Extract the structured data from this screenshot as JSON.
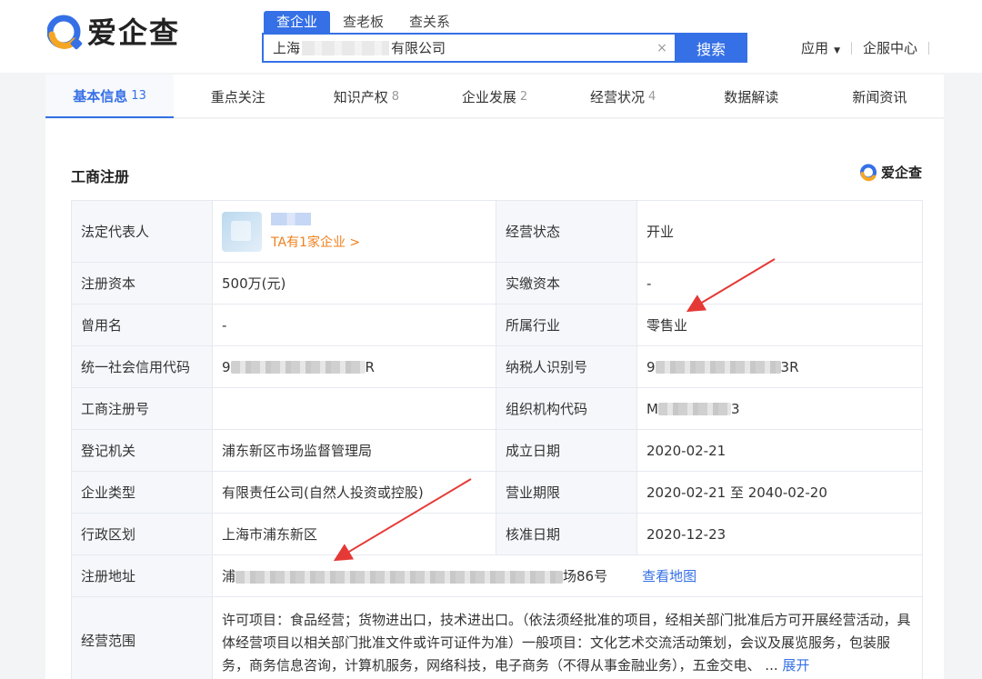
{
  "header": {
    "logo_text": "爱企查",
    "search_tabs": [
      "查企业",
      "查老板",
      "查关系"
    ],
    "search_value_prefix": "上海",
    "search_value_suffix": "有限公司",
    "clear_icon": "×",
    "search_button": "搜索",
    "apps_label": "应用",
    "service_center": "企服中心"
  },
  "nav": {
    "tabs": [
      {
        "label": "基本信息",
        "count": "13"
      },
      {
        "label": "重点关注",
        "count": ""
      },
      {
        "label": "知识产权",
        "count": "8"
      },
      {
        "label": "企业发展",
        "count": "2"
      },
      {
        "label": "经营状况",
        "count": "4"
      },
      {
        "label": "数据解读",
        "count": ""
      },
      {
        "label": "新闻资讯",
        "count": ""
      }
    ]
  },
  "section": {
    "title": "工商注册",
    "brand": "爱企查"
  },
  "registration": {
    "legal_rep_label": "法定代表人",
    "legal_rep_link": "TA有1家企业 >",
    "status_label": "经营状态",
    "status_value": "开业",
    "reg_capital_label": "注册资本",
    "reg_capital_value": "500万(元)",
    "paid_capital_label": "实缴资本",
    "paid_capital_value": "-",
    "former_name_label": "曾用名",
    "former_name_value": "-",
    "industry_label": "所属行业",
    "industry_value": "零售业",
    "credit_code_label": "统一社会信用代码",
    "credit_code_prefix": "9",
    "credit_code_suffix": "R",
    "taxpayer_label": "纳税人识别号",
    "taxpayer_prefix": "9",
    "taxpayer_suffix": "3R",
    "reg_no_label": "工商注册号",
    "reg_no_value": "",
    "org_code_label": "组织机构代码",
    "org_code_prefix": "M",
    "org_code_suffix": "3",
    "authority_label": "登记机关",
    "authority_value": "浦东新区市场监督管理局",
    "established_label": "成立日期",
    "established_value": "2020-02-21",
    "company_type_label": "企业类型",
    "company_type_value": "有限责任公司(自然人投资或控股)",
    "term_label": "营业期限",
    "term_value": "2020-02-21 至 2040-02-20",
    "district_label": "行政区划",
    "district_value": "上海市浦东新区",
    "approval_label": "核准日期",
    "approval_value": "2020-12-23",
    "address_label": "注册地址",
    "address_prefix": "浦",
    "address_suffix": "场86号",
    "map_link": "查看地图",
    "scope_label": "经营范围",
    "scope_value": "许可项目：食品经营；货物进出口，技术进出口。（依法须经批准的项目，经相关部门批准后方可开展经营活动，具体经营项目以相关部门批准文件或许可证件为准）一般项目：文化艺术交流活动策划，会议及展览服务，包装服务，商务信息咨询，计算机服务，网络科技，电子商务（不得从事金融业务），五金交电、",
    "scope_ellipsis": "...",
    "scope_expand": "展开"
  },
  "colors": {
    "accent": "#3570e6",
    "link_orange": "#f0811e",
    "annotation_red": "#e53935"
  },
  "icons": {
    "logo": "aiqicha-logo-icon",
    "caret": "caret-down-icon",
    "clear": "close-icon"
  }
}
